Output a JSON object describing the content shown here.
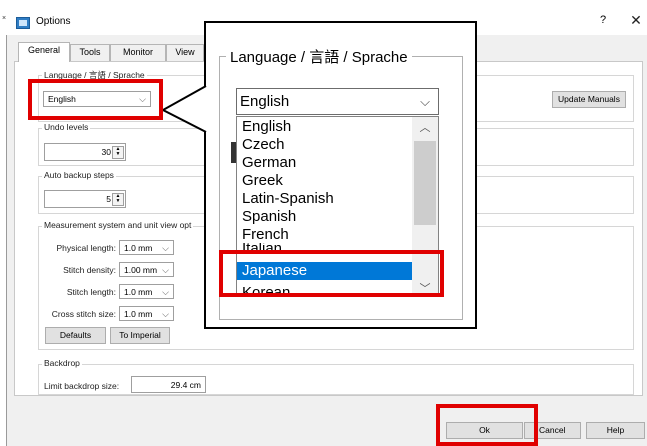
{
  "window": {
    "title": "Options",
    "help_glyph": "?",
    "close_glyph": "✕",
    "left_mark": "×"
  },
  "tabs": [
    {
      "label": "General"
    },
    {
      "label": "Tools"
    },
    {
      "label": "Monitor"
    },
    {
      "label": "View"
    }
  ],
  "language": {
    "legend": "Language / 言語 / Sprache",
    "value": "English"
  },
  "update_manuals_label": "Update Manuals",
  "undo": {
    "legend": "Undo levels",
    "value": "30"
  },
  "autobackup": {
    "legend": "Auto backup steps",
    "value": "5"
  },
  "measurement": {
    "legend": "Measurement system and unit view opt",
    "rows": [
      {
        "label": "Physical length:",
        "value": "1.0 mm"
      },
      {
        "label": "Stitch density:",
        "value": "1.00 mm"
      },
      {
        "label": "Stitch length:",
        "value": "1.0 mm"
      },
      {
        "label": "Cross stitch size:",
        "value": "1.0 mm"
      }
    ],
    "defaults_label": "Defaults",
    "to_imperial_label": "To Imperial"
  },
  "backdrop": {
    "legend": "Backdrop",
    "limit_label": "Limit backdrop size:",
    "limit_value": "29.4 cm"
  },
  "footer": {
    "ok_label": "Ok",
    "cancel_label": "Cancel",
    "help_label": "Help"
  },
  "callout": {
    "legend": "Language / 言語 / Sprache",
    "selected": "English",
    "options": [
      "English",
      "Czech",
      "German",
      "Greek",
      "Latin-Spanish",
      "Spanish",
      "French",
      "Italian",
      "Japanese",
      "Korean"
    ],
    "highlighted": "Japanese"
  },
  "colors": {
    "highlight_red": "#e00000",
    "selection_blue": "#0078d7"
  }
}
